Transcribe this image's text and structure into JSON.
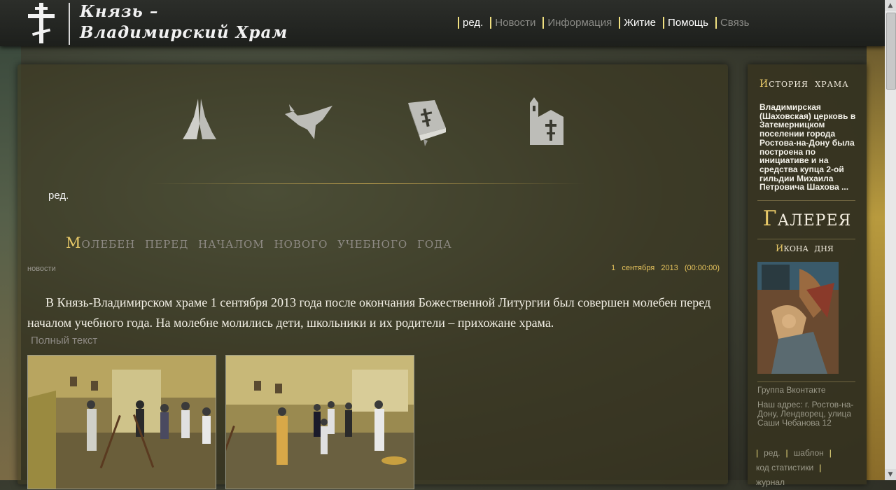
{
  "header": {
    "logo_line1": "Князь –",
    "logo_line2": "Владимирский Храм",
    "nav": [
      {
        "label": "ред.",
        "active": true
      },
      {
        "label": "Новости",
        "active": false
      },
      {
        "label": "Информация",
        "active": false
      },
      {
        "label": "Житие",
        "active": true
      },
      {
        "label": "Помощь",
        "active": true
      },
      {
        "label": "Связь",
        "active": false
      }
    ]
  },
  "icons": [
    "praying-hands-icon",
    "dove-icon",
    "bible-icon",
    "church-icon"
  ],
  "main": {
    "edit_label": "ред.",
    "post": {
      "title_first": "М",
      "title_rest": "олебен перед началом нового учебного года",
      "category": "новости",
      "date": "1 сентября 2013 (00:00:00)",
      "body": "В Князь-Владимирском храме 1 сентября 2013 года после окончания Божественной Литургии был совершен молебен перед началом учебного года. На молебне молились дети, школьники и их родители – прихожане храма.",
      "full_text_link": "Полный текст"
    }
  },
  "sidebar": {
    "history_title_first": "И",
    "history_title_rest": "стория храма",
    "history_text": "Владимирская (Шаховская) церковь в Затемерницком поселении города Ростова-на-Дону была построена по инициативе и на средства купца 2-ой гильдии Михаила Петровича Шахова ...",
    "gallery_first": "Г",
    "gallery_rest": "алерея",
    "icon_day_first": "И",
    "icon_day_rest": "кона дня",
    "vk_label": "Группа Вконтакте",
    "address": "Наш адрес: г. Ростов-на-Дону, Лендворец, улица Саши Чебанова 12",
    "links": [
      "ред.",
      "шаблон",
      "код статистики",
      "журнал"
    ]
  }
}
